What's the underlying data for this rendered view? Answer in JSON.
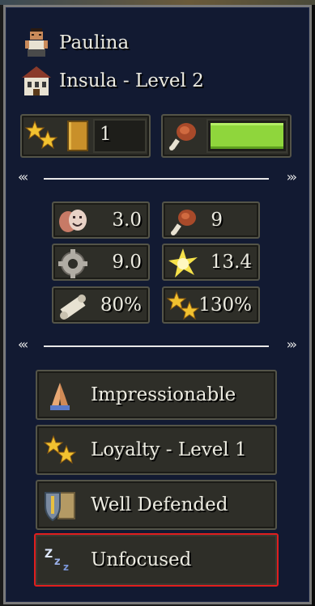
{
  "citizen": {
    "name": "Paulina",
    "home": "Insula - Level 2",
    "icons": {
      "citizen": "citizen-portrait-icon",
      "home": "insula-house-icon"
    }
  },
  "top_bars": {
    "level": {
      "icon": "gold-stars-icon",
      "value": "1",
      "bar_icon": "gold-bar-icon"
    },
    "food": {
      "icon": "meat-leg-icon",
      "fill_fraction": 1.0,
      "bar_color": "#8fd63c"
    }
  },
  "stats": [
    {
      "icon": "theater-masks-icon",
      "value": "3.0"
    },
    {
      "icon": "meat-leg-icon",
      "value": "9"
    },
    {
      "icon": "gear-icon",
      "value": "9.0"
    },
    {
      "icon": "sun-burst-icon",
      "value": "13.4"
    },
    {
      "icon": "scroll-icon",
      "value": "80%"
    },
    {
      "icon": "gold-stars-icon",
      "value": "130%"
    }
  ],
  "traits": [
    {
      "icon": "praying-hands-icon",
      "label": "Impressionable",
      "selected": false
    },
    {
      "icon": "gold-stars-icon",
      "label": "Loyalty - Level 1",
      "selected": false
    },
    {
      "icon": "shield-map-icon",
      "label": "Well Defended",
      "selected": false
    },
    {
      "icon": "sleep-zzz-icon",
      "label": "Unfocused",
      "selected": true
    }
  ],
  "colors": {
    "panel": "#121a32",
    "box": "#2e2e28",
    "selected_border": "#e01e1e",
    "food_bar": "#8fd63c"
  }
}
